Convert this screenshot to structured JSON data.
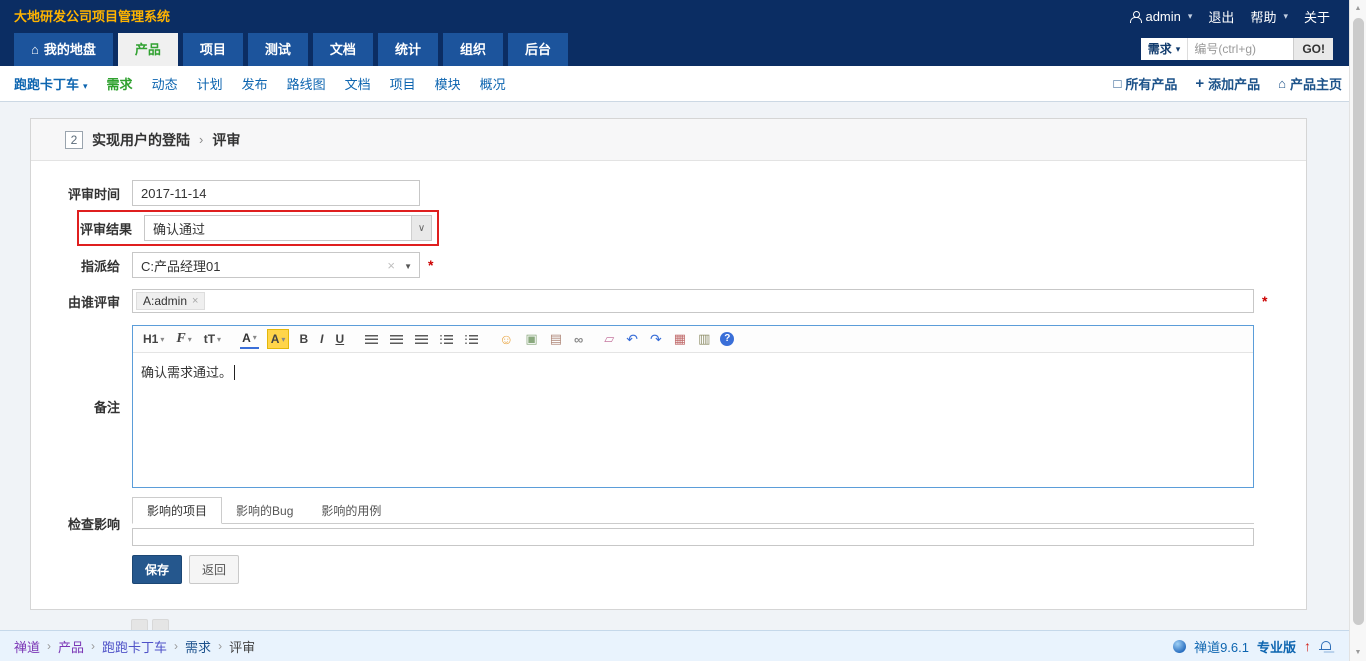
{
  "topbar": {
    "title": "大地研发公司项目管理系统",
    "user": "admin",
    "logout": "退出",
    "help": "帮助",
    "about": "关于"
  },
  "mainnav": {
    "tabs": [
      {
        "label": "我的地盘"
      },
      {
        "label": "产品"
      },
      {
        "label": "项目"
      },
      {
        "label": "测试"
      },
      {
        "label": "文档"
      },
      {
        "label": "统计"
      },
      {
        "label": "组织"
      },
      {
        "label": "后台"
      }
    ],
    "search": {
      "category": "需求",
      "placeholder": "编号(ctrl+g)",
      "go": "GO!"
    }
  },
  "subnav": {
    "product": "跑跑卡丁车",
    "items": [
      {
        "label": "需求"
      },
      {
        "label": "动态"
      },
      {
        "label": "计划"
      },
      {
        "label": "发布"
      },
      {
        "label": "路线图"
      },
      {
        "label": "文档"
      },
      {
        "label": "项目"
      },
      {
        "label": "模块"
      },
      {
        "label": "概况"
      }
    ],
    "actions": [
      {
        "label": "所有产品"
      },
      {
        "label": "添加产品"
      },
      {
        "label": "产品主页"
      }
    ]
  },
  "form": {
    "header": {
      "story_id": "2",
      "story_title": "实现用户的登陆",
      "sep": "›",
      "action": "评审"
    },
    "review_date": {
      "label": "评审时间",
      "value": "2017-11-14"
    },
    "review_result": {
      "label": "评审结果",
      "value": "确认通过"
    },
    "assigned_to": {
      "label": "指派给",
      "value": "C:产品经理01",
      "clear": "×",
      "required": "*"
    },
    "reviewed_by": {
      "label": "由谁评审",
      "tag": "A:admin",
      "tag_remove": "×",
      "required": "*"
    },
    "comment": {
      "label": "备注",
      "value": "确认需求通过。"
    },
    "impact": {
      "label": "检查影响",
      "tabs": [
        {
          "label": "影响的项目"
        },
        {
          "label": "影响的Bug"
        },
        {
          "label": "影响的用例"
        }
      ]
    },
    "save": "保存",
    "back": "返回"
  },
  "editor": {
    "toolbar": [
      {
        "name": "heading-icon",
        "glyph": "H1"
      },
      {
        "name": "font-family-icon",
        "glyph": "F"
      },
      {
        "name": "font-size-icon",
        "glyph": "tT"
      },
      {
        "name": "text-color-icon",
        "glyph": "A"
      },
      {
        "name": "highlight-color-icon",
        "glyph": "A"
      },
      {
        "name": "bold-icon",
        "glyph": "B"
      },
      {
        "name": "italic-icon",
        "glyph": "I"
      },
      {
        "name": "underline-icon",
        "glyph": "U"
      },
      {
        "name": "align-left-icon",
        "glyph": ""
      },
      {
        "name": "align-center-icon",
        "glyph": ""
      },
      {
        "name": "align-right-icon",
        "glyph": ""
      },
      {
        "name": "ordered-list-icon",
        "glyph": ""
      },
      {
        "name": "unordered-list-icon",
        "glyph": ""
      },
      {
        "name": "emoticon-icon",
        "glyph": "☺"
      },
      {
        "name": "image-icon",
        "glyph": "▣"
      },
      {
        "name": "media-icon",
        "glyph": "▤"
      },
      {
        "name": "link-icon",
        "glyph": "∞"
      },
      {
        "name": "remove-format-icon",
        "glyph": "▱"
      },
      {
        "name": "undo-icon",
        "glyph": "↶"
      },
      {
        "name": "redo-icon",
        "glyph": "↷"
      },
      {
        "name": "table-icon",
        "glyph": "▦"
      },
      {
        "name": "source-icon",
        "glyph": "▥"
      },
      {
        "name": "about-icon",
        "glyph": "?"
      }
    ]
  },
  "footer": {
    "sep": "›",
    "breadcrumb": [
      {
        "label": "禅道"
      },
      {
        "label": "产品"
      },
      {
        "label": "跑跑卡丁车"
      },
      {
        "label": "需求"
      },
      {
        "label": "评审"
      }
    ],
    "version": "禅道9.6.1",
    "edition": "专业版"
  },
  "colors": {
    "navy": "#0b2d63",
    "tab_blue": "#1c549c",
    "active_green": "#32a232",
    "link_blue": "#0d65b0",
    "title_yellow": "#ffb400",
    "highlight_red": "#df1f1f",
    "save_blue": "#25578d",
    "required_red": "#cc0000"
  }
}
